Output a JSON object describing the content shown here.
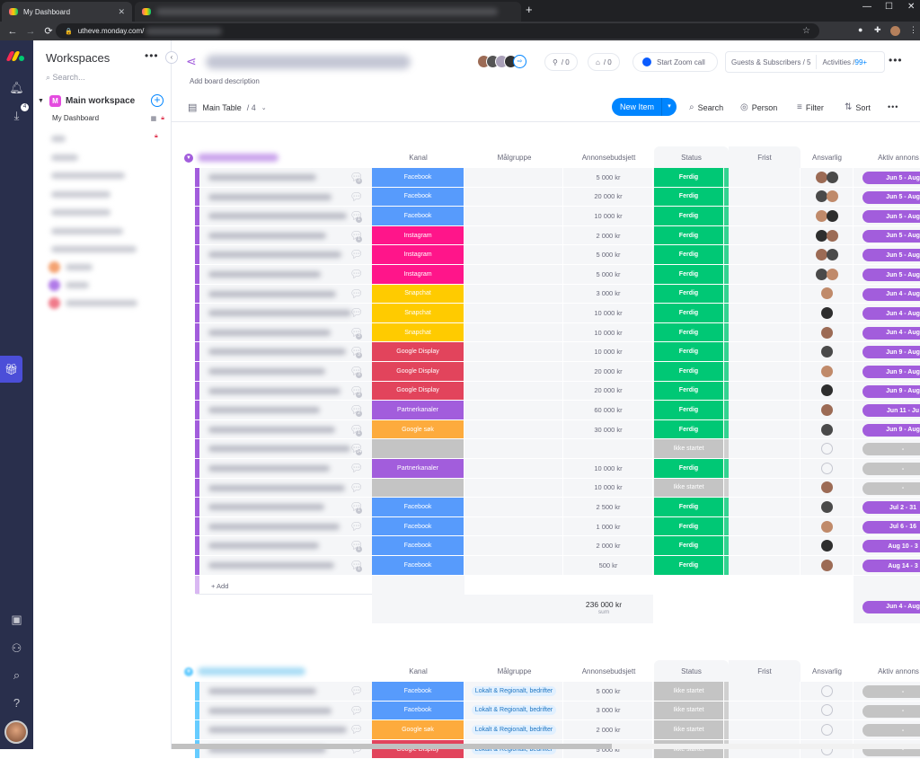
{
  "browser": {
    "active_tab": "My Dashboard",
    "url": "utheve.monday.com/",
    "new_tab": "+"
  },
  "left_nav": {
    "inbox_badge": "4"
  },
  "workspaces": {
    "title": "Workspaces",
    "search_placeholder": "Search...",
    "main_workspace": "Main workspace",
    "workspace_initial": "M",
    "items": [
      "My Dashboard"
    ]
  },
  "board": {
    "description": "Add board description",
    "integrations_count": "/ 0",
    "automations_count": "/ 0",
    "zoom_label": "Start Zoom call",
    "guests_label": "Guests & Subscribers / 5",
    "activities_label": "Activities /",
    "activities_count": "99+",
    "view_label": "Main Table",
    "view_count": "/ 4",
    "new_item": "New Item",
    "search": "Search",
    "person": "Person",
    "filter": "Filter",
    "sort": "Sort"
  },
  "columns": [
    "Kanal",
    "Målgruppe",
    "Annonsebudsjett",
    "Status",
    "Frist",
    "Ansvarlig",
    "Aktiv annons"
  ],
  "colors": {
    "Facebook": "#579bfc",
    "Instagram": "#ff158a",
    "Snapchat": "#ffcb00",
    "Google Display": "#e2445c",
    "Partnerkanaler": "#a25ddc",
    "Google søk": "#fdab3d",
    "empty": "#c4c4c4",
    "Ferdig": "#00c875",
    "Ikke startet": "#c4c4c4",
    "group1": "#a25ddc",
    "group2": "#66ccff",
    "timeline": "#a25ddc"
  },
  "group1": {
    "add_label": "+ Add",
    "sum_value": "236 000 kr",
    "sum_label": "sum",
    "sum_timeline": "Jun 4 - Aug",
    "rows": [
      {
        "comments": "3",
        "kanal": "Facebook",
        "budget": "5 000 kr",
        "status": "Ferdig",
        "people": 2,
        "timeline": "Jun 5 - Aug"
      },
      {
        "comments": "",
        "kanal": "Facebook",
        "budget": "20 000 kr",
        "status": "Ferdig",
        "people": 2,
        "timeline": "Jun 5 - Aug"
      },
      {
        "comments": "1",
        "kanal": "Facebook",
        "budget": "10 000 kr",
        "status": "Ferdig",
        "people": 2,
        "timeline": "Jun 5 - Aug"
      },
      {
        "comments": "1",
        "kanal": "Instagram",
        "budget": "2 000 kr",
        "status": "Ferdig",
        "people": 2,
        "timeline": "Jun 5 - Aug"
      },
      {
        "comments": "",
        "kanal": "Instagram",
        "budget": "5 000 kr",
        "status": "Ferdig",
        "people": 2,
        "timeline": "Jun 5 - Aug"
      },
      {
        "comments": "",
        "kanal": "Instagram",
        "budget": "5 000 kr",
        "status": "Ferdig",
        "people": 2,
        "timeline": "Jun 5 - Aug"
      },
      {
        "comments": "",
        "kanal": "Snapchat",
        "budget": "3 000 kr",
        "status": "Ferdig",
        "people": 1,
        "timeline": "Jun 4 - Aug"
      },
      {
        "comments": "",
        "kanal": "Snapchat",
        "budget": "10 000 kr",
        "status": "Ferdig",
        "people": 1,
        "timeline": "Jun 4 - Aug"
      },
      {
        "comments": "3",
        "kanal": "Snapchat",
        "budget": "10 000 kr",
        "status": "Ferdig",
        "people": 1,
        "timeline": "Jun 4 - Aug"
      },
      {
        "comments": "3",
        "kanal": "Google Display",
        "budget": "10 000 kr",
        "status": "Ferdig",
        "people": 1,
        "timeline": "Jun 9 - Aug"
      },
      {
        "comments": "3",
        "kanal": "Google Display",
        "budget": "20 000 kr",
        "status": "Ferdig",
        "people": 1,
        "timeline": "Jun 9 - Aug"
      },
      {
        "comments": "3",
        "kanal": "Google Display",
        "budget": "20 000 kr",
        "status": "Ferdig",
        "people": 1,
        "timeline": "Jun 9 - Aug"
      },
      {
        "comments": "2",
        "kanal": "Partnerkanaler",
        "budget": "60 000 kr",
        "status": "Ferdig",
        "people": 1,
        "timeline": "Jun 11 - Ju"
      },
      {
        "comments": "1",
        "kanal": "Google søk",
        "budget": "30 000 kr",
        "status": "Ferdig",
        "people": 1,
        "timeline": "Jun 9 - Aug"
      },
      {
        "comments": "14",
        "kanal": "",
        "budget": "",
        "status": "Ikke startet",
        "people": 0,
        "timeline": "-"
      },
      {
        "comments": "",
        "kanal": "Partnerkanaler",
        "budget": "10 000 kr",
        "status": "Ferdig",
        "people": 0,
        "timeline": "-"
      },
      {
        "comments": "",
        "kanal": "",
        "budget": "10 000 kr",
        "status": "Ikke startet",
        "people": 1,
        "timeline": "-"
      },
      {
        "comments": "1",
        "kanal": "Facebook",
        "budget": "2 500 kr",
        "status": "Ferdig",
        "people": 1,
        "timeline": "Jul 2 - 31"
      },
      {
        "comments": "",
        "kanal": "Facebook",
        "budget": "1 000 kr",
        "status": "Ferdig",
        "people": 1,
        "timeline": "Jul 6 - 16"
      },
      {
        "comments": "1",
        "kanal": "Facebook",
        "budget": "2 000 kr",
        "status": "Ferdig",
        "people": 1,
        "timeline": "Aug 10 - 3"
      },
      {
        "comments": "1",
        "kanal": "Facebook",
        "budget": "500 kr",
        "status": "Ferdig",
        "people": 1,
        "timeline": "Aug 14 - 3"
      }
    ]
  },
  "group2": {
    "rows": [
      {
        "comments": "",
        "kanal": "Facebook",
        "malgruppe": "Lokalt & Regionalt, bedrifter",
        "budget": "5 000 kr",
        "status": "Ikke startet",
        "people": 0,
        "timeline": "-"
      },
      {
        "comments": "",
        "kanal": "Facebook",
        "malgruppe": "Lokalt & Regionalt, bedrifter",
        "budget": "3 000 kr",
        "status": "Ikke startet",
        "people": 0,
        "timeline": "-"
      },
      {
        "comments": "",
        "kanal": "Google søk",
        "malgruppe": "Lokalt & Regionalt, bedrifter",
        "budget": "2 000 kr",
        "status": "Ikke startet",
        "people": 0,
        "timeline": "-"
      },
      {
        "comments": "",
        "kanal": "Google Display",
        "malgruppe": "Lokalt & Regionalt, bedrifter",
        "budget": "5 000 kr",
        "status": "Ikke startet",
        "people": 0,
        "timeline": "-"
      }
    ]
  }
}
